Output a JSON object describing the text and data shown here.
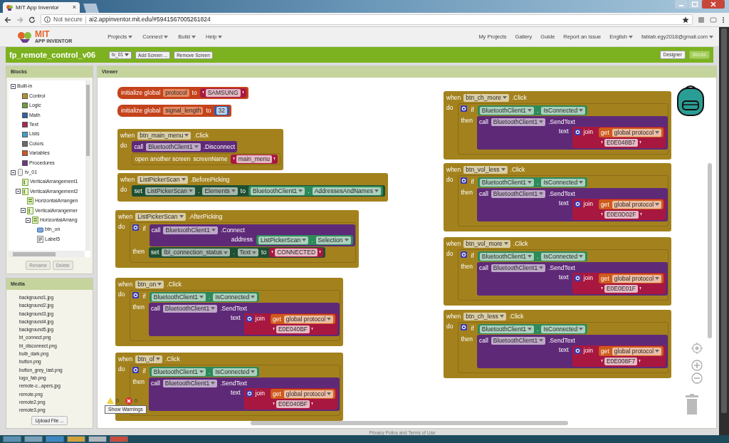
{
  "browser": {
    "tab": {
      "title": "MIT App Inventor",
      "close": "×"
    },
    "security": "Not secure",
    "url": "ai2.appinventor.mit.edu/#5941567005261824"
  },
  "header": {
    "logo_title": "MIT",
    "logo_subtitle": "APP INVENTOR",
    "menus": [
      "Projects",
      "Connect",
      "Build",
      "Help"
    ],
    "links": [
      "My Projects",
      "Gallery",
      "Guide",
      "Report an Issue"
    ],
    "language": "English",
    "account": "fablab.egy2018@gmail.com"
  },
  "project_bar": {
    "name": "fp_remote_control_v06",
    "screen": "tv_01",
    "buttons": [
      "Add Screen ...",
      "Remove Screen"
    ],
    "modes": [
      {
        "label": "Designer",
        "selected": false
      },
      {
        "label": "Blocks",
        "selected": true
      }
    ]
  },
  "blocks_panel": {
    "title": "Blocks",
    "tree": [
      {
        "label": "Built-in",
        "expanded": true,
        "children": [
          {
            "label": "Control",
            "color": "#b5902e"
          },
          {
            "label": "Logic",
            "color": "#6e9e36"
          },
          {
            "label": "Math",
            "color": "#2f5fa8"
          },
          {
            "label": "Text",
            "color": "#b0254f"
          },
          {
            "label": "Lists",
            "color": "#3ea0cc"
          },
          {
            "label": "Colors",
            "color": "#6b6b6b"
          },
          {
            "label": "Variables",
            "color": "#d0561f"
          },
          {
            "label": "Procedures",
            "color": "#6e3585"
          }
        ]
      },
      {
        "label": "tv_01",
        "kind": "screen",
        "expanded": true,
        "children": [
          {
            "label": "VerticalArrangement1",
            "kind": "vertical"
          },
          {
            "label": "VerticalArrangement2",
            "kind": "vertical",
            "expanded": true,
            "children": [
              {
                "label": "HorizontalArrangen",
                "kind": "horizontal"
              },
              {
                "label": "VerticalArrangemer",
                "kind": "vertical",
                "expanded": true,
                "children": [
                  {
                    "label": "HorizontalArrang",
                    "kind": "horizontal",
                    "expanded": true,
                    "children": [
                      {
                        "label": "btn_on",
                        "kind": "button"
                      },
                      {
                        "label": "Label5",
                        "kind": "label"
                      }
                    ]
                  }
                ]
              }
            ]
          }
        ]
      }
    ],
    "buttons": [
      "Rename",
      "Delete"
    ]
  },
  "media": {
    "title": "Media",
    "files": [
      "background1.jpg",
      "background2.jpg",
      "background3.jpg",
      "background4.jpg",
      "background5.jpg",
      "bt_connect.png",
      "bt_disconnect.png",
      "bulb_dark.png",
      "button.png",
      "button_grey_last.png",
      "logo_fab.png",
      "remote-c...apers.jpg",
      "remote.png",
      "remote2.png",
      "remote3.png"
    ],
    "upload": "Upload File ..."
  },
  "viewer": {
    "title": "Viewer",
    "blocks": [
      {
        "kind": "init",
        "label": "initialize global",
        "name": "protocol",
        "to": "to",
        "value": {
          "kind": "text",
          "value": "SAMSUNG"
        }
      },
      {
        "kind": "init",
        "label": "initialize global",
        "name": "signal_length",
        "to": "to",
        "value": {
          "kind": "number",
          "value": "32"
        }
      },
      {
        "kind": "event",
        "when": "when",
        "component": "btn_main_menu",
        "event": ".Click",
        "do": "do",
        "body": [
          {
            "kind": "call",
            "label": "call",
            "component": "BluetoothClient1",
            "method": ".Disconnect"
          },
          {
            "kind": "open_screen",
            "label": "open another screen",
            "arg_label": "screenName",
            "value": {
              "kind": "text",
              "value": "main_menu"
            }
          }
        ]
      },
      {
        "kind": "event",
        "when": "when",
        "component": "ListPickerScan",
        "event": ".BeforePicking",
        "do": "do",
        "body": [
          {
            "kind": "set",
            "label": "set",
            "component": "ListPickerScan",
            "sep": ".",
            "property": "Elements",
            "to": "to",
            "value": {
              "kind": "prop",
              "component": "BluetoothClient1",
              "sep": ".",
              "property": "AddressesAndNames"
            }
          }
        ]
      },
      {
        "kind": "event",
        "when": "when",
        "component": "ListPickerScan",
        "event": ".AfterPicking",
        "do": "do",
        "body": [
          {
            "kind": "if",
            "label": "if",
            "then_label": "then",
            "condition": {
              "kind": "call",
              "label": "call",
              "component": "BluetoothClient1",
              "method": ".Connect",
              "args": [
                {
                  "label": "address",
                  "value": {
                    "kind": "prop",
                    "component": "ListPickerScan",
                    "sep": ".",
                    "property": "Selection"
                  }
                }
              ]
            },
            "then": [
              {
                "kind": "set",
                "label": "set",
                "component": "lbl_connection_status",
                "sep": ".",
                "property": "Text",
                "to": "to",
                "value": {
                  "kind": "text",
                  "value": "CONNECTED"
                }
              }
            ]
          }
        ]
      },
      {
        "kind": "event",
        "when": "when",
        "component": "btn_on",
        "event": ".Click",
        "do": "do",
        "body": [
          {
            "kind": "if",
            "label": "if",
            "then_label": "then",
            "condition": {
              "kind": "prop",
              "component": "BluetoothClient1",
              "sep": ".",
              "property": "IsConnected"
            },
            "then": [
              {
                "kind": "call",
                "label": "call",
                "component": "BluetoothClient1",
                "method": ".SendText",
                "args": [
                  {
                    "label": "text",
                    "value": {
                      "kind": "join",
                      "label": "join",
                      "items": [
                        {
                          "kind": "get",
                          "label": "get",
                          "var": "global protocol"
                        },
                        {
                          "kind": "text",
                          "value": "E0E040BF"
                        }
                      ]
                    }
                  }
                ]
              }
            ]
          }
        ]
      },
      {
        "kind": "event",
        "when": "when",
        "component": "btn_of",
        "event": ".Click",
        "do": "do",
        "body": [
          {
            "kind": "if",
            "label": "if",
            "then_label": "then",
            "condition": {
              "kind": "prop",
              "component": "BluetoothClient1",
              "sep": ".",
              "property": "IsConnected"
            },
            "then": [
              {
                "kind": "call",
                "label": "call",
                "component": "BluetoothClient1",
                "method": ".SendText",
                "args": [
                  {
                    "label": "text",
                    "value": {
                      "kind": "join",
                      "label": "join",
                      "items": [
                        {
                          "kind": "get",
                          "label": "get",
                          "var": "global protocol"
                        },
                        {
                          "kind": "text",
                          "value": "E0E040BF"
                        }
                      ]
                    }
                  }
                ]
              }
            ]
          }
        ]
      },
      {
        "kind": "event",
        "when": "when",
        "component": "btn_ch_more",
        "event": ".Click",
        "do": "do",
        "body": [
          {
            "kind": "if",
            "label": "if",
            "then_label": "then",
            "condition": {
              "kind": "prop",
              "component": "BluetoothClient1",
              "sep": ".",
              "property": "IsConnected"
            },
            "then": [
              {
                "kind": "call",
                "label": "call",
                "component": "BluetoothClient1",
                "method": ".SendText",
                "args": [
                  {
                    "label": "text",
                    "value": {
                      "kind": "join",
                      "label": "join",
                      "items": [
                        {
                          "kind": "get",
                          "label": "get",
                          "var": "global protocol"
                        },
                        {
                          "kind": "text",
                          "value": "E0E048B7"
                        }
                      ]
                    }
                  }
                ]
              }
            ]
          }
        ]
      },
      {
        "kind": "event",
        "when": "when",
        "component": "btn_vol_less",
        "event": ".Click",
        "do": "do",
        "body": [
          {
            "kind": "if",
            "label": "if",
            "then_label": "then",
            "condition": {
              "kind": "prop",
              "component": "BluetoothClient1",
              "sep": ".",
              "property": "IsConnected"
            },
            "then": [
              {
                "kind": "call",
                "label": "call",
                "component": "BluetoothClient1",
                "method": ".SendText",
                "args": [
                  {
                    "label": "text",
                    "value": {
                      "kind": "join",
                      "label": "join",
                      "items": [
                        {
                          "kind": "get",
                          "label": "get",
                          "var": "global protocol"
                        },
                        {
                          "kind": "text",
                          "value": "E0E0D02F"
                        }
                      ]
                    }
                  }
                ]
              }
            ]
          }
        ]
      },
      {
        "kind": "event",
        "when": "when",
        "component": "btn_vol_more",
        "event": ".Click",
        "do": "do",
        "body": [
          {
            "kind": "if",
            "label": "if",
            "then_label": "then",
            "condition": {
              "kind": "prop",
              "component": "BluetoothClient1",
              "sep": ".",
              "property": "IsConnected"
            },
            "then": [
              {
                "kind": "call",
                "label": "call",
                "component": "BluetoothClient1",
                "method": ".SendText",
                "args": [
                  {
                    "label": "text",
                    "value": {
                      "kind": "join",
                      "label": "join",
                      "items": [
                        {
                          "kind": "get",
                          "label": "get",
                          "var": "global protocol"
                        },
                        {
                          "kind": "text",
                          "value": "E0E0E01F"
                        }
                      ]
                    }
                  }
                ]
              }
            ]
          }
        ]
      },
      {
        "kind": "event",
        "when": "when",
        "component": "btn_ch_less",
        "event": ".Click",
        "do": "do",
        "body": [
          {
            "kind": "if",
            "label": "if",
            "then_label": "then",
            "condition": {
              "kind": "prop",
              "component": "BluetoothClient1",
              "sep": ".",
              "property": "IsConnected"
            },
            "then": [
              {
                "kind": "call",
                "label": "call",
                "component": "BluetoothClient1",
                "method": ".SendText",
                "args": [
                  {
                    "label": "text",
                    "value": {
                      "kind": "join",
                      "label": "join",
                      "items": [
                        {
                          "kind": "get",
                          "label": "get",
                          "var": "global protocol"
                        },
                        {
                          "kind": "text",
                          "value": "E0E008F7"
                        }
                      ]
                    }
                  }
                ]
              }
            ]
          }
        ]
      }
    ],
    "warnings": {
      "warning_count": "0",
      "error_count": "0",
      "button": "Show Warnings"
    }
  },
  "footer": "Privacy Policy and Terms of Use"
}
